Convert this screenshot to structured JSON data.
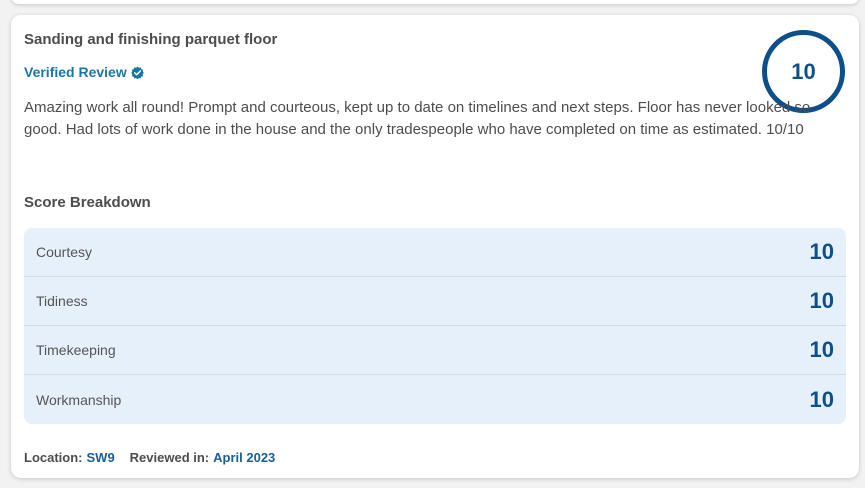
{
  "review": {
    "title": "Sanding and finishing parquet floor",
    "verified_label": "Verified Review",
    "overall_score": "10",
    "text": "Amazing work all round! Prompt and courteous, kept up to date on timelines and next steps. Floor has never looked so good. Had lots of work done in the house and the only tradespeople who have completed on time as estimated. 10/10"
  },
  "breakdown": {
    "title": "Score Breakdown",
    "rows": [
      {
        "label": "Courtesy",
        "score": "10"
      },
      {
        "label": "Tidiness",
        "score": "10"
      },
      {
        "label": "Timekeeping",
        "score": "10"
      },
      {
        "label": "Workmanship",
        "score": "10"
      }
    ]
  },
  "footer": {
    "location_label": "Location:",
    "location_value": "SW9",
    "reviewed_label": "Reviewed in:",
    "reviewed_value": "April 2023"
  },
  "colors": {
    "accent": "#0d4f8a",
    "link": "#1976a8",
    "breakdown_bg": "#e5f0fa"
  },
  "icons": {
    "verified": "verified-check-icon"
  }
}
